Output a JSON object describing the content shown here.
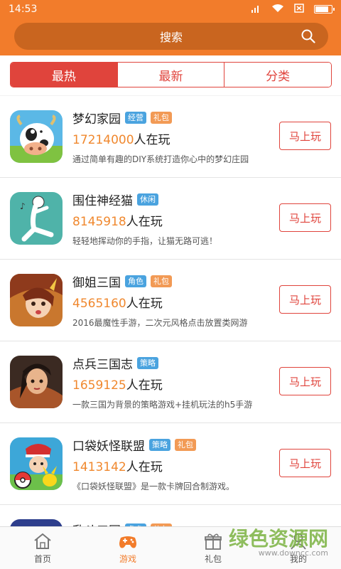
{
  "status": {
    "time": "14:53"
  },
  "search": {
    "label": "搜索"
  },
  "tabs": [
    {
      "label": "最热",
      "active": true
    },
    {
      "label": "最新",
      "active": false
    },
    {
      "label": "分类",
      "active": false
    }
  ],
  "games": [
    {
      "name": "梦幻家园",
      "tags": [
        {
          "label": "经营",
          "color": "blue"
        },
        {
          "label": "礼包",
          "color": "orange"
        }
      ],
      "players_num": "17214000",
      "players_suffix": "人在玩",
      "desc": "通过简单有趣的DIY系统打造你心中的梦幻庄园",
      "button": "马上玩"
    },
    {
      "name": "围住神经猫",
      "tags": [
        {
          "label": "休闲",
          "color": "blue"
        }
      ],
      "players_num": "8145918",
      "players_suffix": "人在玩",
      "desc": "轻轻地挥动你的手指，让猫无路可逃！",
      "button": "马上玩"
    },
    {
      "name": "御姐三国",
      "tags": [
        {
          "label": "角色",
          "color": "blue"
        },
        {
          "label": "礼包",
          "color": "orange"
        }
      ],
      "players_num": "4565160",
      "players_suffix": "人在玩",
      "desc": "2016最魔性手游，二次元风格点击放置类网游",
      "button": "马上玩"
    },
    {
      "name": "点兵三国志",
      "tags": [
        {
          "label": "策略",
          "color": "blue"
        }
      ],
      "players_num": "1659125",
      "players_suffix": "人在玩",
      "desc": "一款三国为背景的策略游戏+挂机玩法的h5手游",
      "button": "马上玩"
    },
    {
      "name": "口袋妖怪联盟",
      "tags": [
        {
          "label": "策略",
          "color": "blue"
        },
        {
          "label": "礼包",
          "color": "orange"
        }
      ],
      "players_num": "1413142",
      "players_suffix": "人在玩",
      "desc": "《口袋妖怪联盟》是一款卡牌回合制游戏。",
      "button": "马上玩"
    }
  ],
  "partial_game": {
    "name": "乱斗三国",
    "tags": [
      {
        "label": "角色",
        "color": "blue"
      },
      {
        "label": "礼包",
        "color": "orange"
      }
    ]
  },
  "nav": [
    {
      "label": "首页",
      "icon": "home-icon",
      "active": false
    },
    {
      "label": "游戏",
      "icon": "gamepad-icon",
      "active": true
    },
    {
      "label": "礼包",
      "icon": "gift-icon",
      "active": false
    },
    {
      "label": "我的",
      "icon": "user-icon",
      "active": false
    }
  ],
  "watermark": {
    "title": "绿色资源网",
    "url": "www.downcc.com"
  },
  "colors": {
    "primary": "#f27c2b",
    "accent": "#e0443c",
    "tag_blue": "#4aa3df",
    "tag_orange": "#f29a55"
  }
}
